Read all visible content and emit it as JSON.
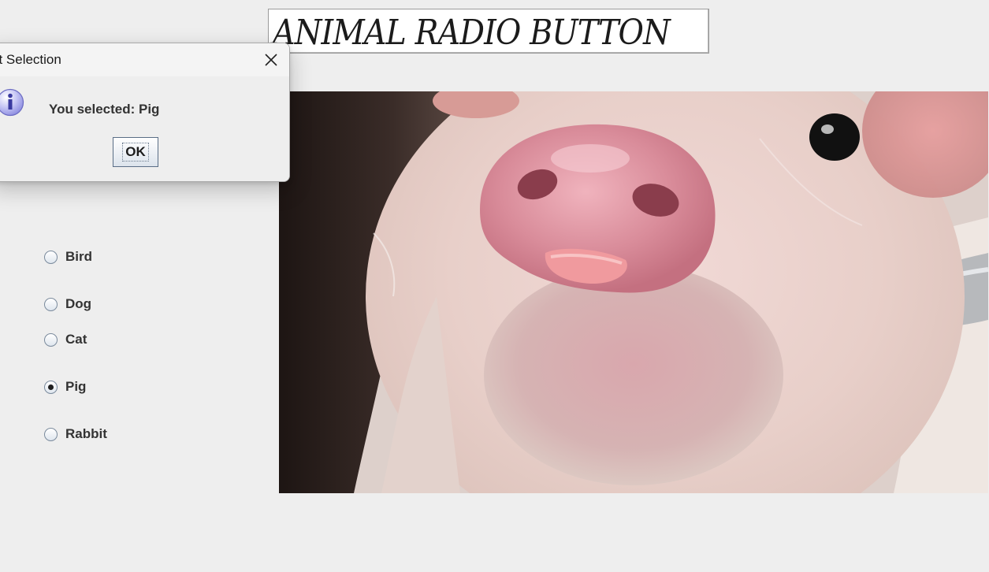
{
  "banner": {
    "title": "ANIMAL RADIO BUTTON"
  },
  "radio_group": {
    "options": [
      {
        "label": "Bird",
        "selected": false
      },
      {
        "label": "Dog",
        "selected": false
      },
      {
        "label": "Cat",
        "selected": false
      },
      {
        "label": "Pig",
        "selected": true
      },
      {
        "label": "Rabbit",
        "selected": false
      }
    ]
  },
  "photo": {
    "subject": "pig"
  },
  "dialog": {
    "title": "et Selection",
    "message": "You selected: Pig",
    "ok_label": "OK",
    "icon": "info-icon",
    "close_icon": "close-icon"
  },
  "colors": {
    "window_bg": "#eeeeee",
    "dialog_bg": "#eeeeee",
    "titlebar_bg": "#f4f4f4",
    "text": "#333333"
  }
}
